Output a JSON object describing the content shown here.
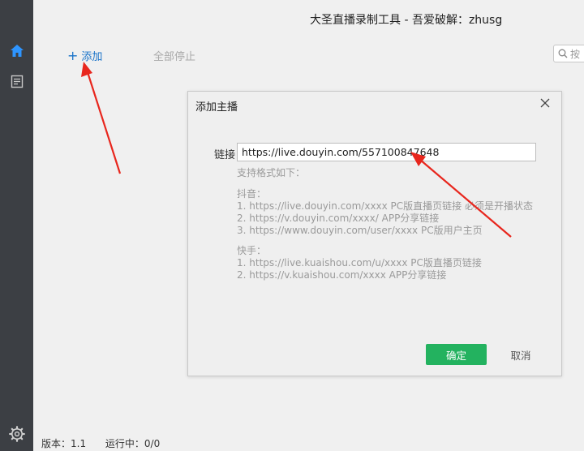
{
  "window": {
    "title": "大圣直播录制工具 - 吾爱破解：zhusg"
  },
  "sidebar": {
    "items": [
      {
        "icon": "home-icon"
      },
      {
        "icon": "document-icon"
      }
    ],
    "bottom_icon": "gear-icon"
  },
  "toolbar": {
    "add_label": "添加",
    "stop_all_label": "全部停止",
    "search_placeholder": "按"
  },
  "status": {
    "version": "版本：1.1",
    "running": "运行中：0/0"
  },
  "dialog": {
    "title": "添加主播",
    "link_label": "链接",
    "link_value": "https://live.douyin.com/557100847648",
    "help": {
      "heading": "支持格式如下：",
      "douyin_title": "抖音：",
      "douyin_lines": [
        "1. https://live.douyin.com/xxxx PC版直播页链接 必须是开播状态",
        "2. https://v.douyin.com/xxxx/ APP分享链接",
        "3. https://www.douyin.com/user/xxxx PC版用户主页"
      ],
      "kuaishou_title": "快手：",
      "kuaishou_lines": [
        "1. https://live.kuaishou.com/u/xxxx PC版直播页链接",
        "2. https://v.kuaishou.com/xxxx APP分享链接"
      ]
    },
    "ok_label": "确定",
    "cancel_label": "取消"
  },
  "colors": {
    "sidebar_bg": "#3c3f44",
    "accent_blue": "#1a73c9",
    "ok_green": "#23b25f",
    "annotation_red": "#e8261d"
  }
}
